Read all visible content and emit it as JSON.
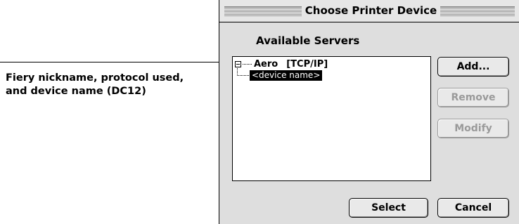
{
  "callout": {
    "line1": "Fiery nickname, protocol used,",
    "line2": "and device name (DC12)"
  },
  "dialog": {
    "title": "Choose Printer Device",
    "section_label": "Available Servers",
    "server": {
      "name": "Aero",
      "protocol": "[TCP/IP]",
      "expanded": true
    },
    "device": "<device name>",
    "buttons": {
      "add": "Add...",
      "remove": "Remove",
      "modify": "Modify",
      "select": "Select",
      "cancel": "Cancel"
    }
  },
  "colors": {
    "dialog_bg": "#dedede",
    "selection_bg": "#000000",
    "selection_text": "#ffffff",
    "disabled_text": "#9a9a9a"
  }
}
